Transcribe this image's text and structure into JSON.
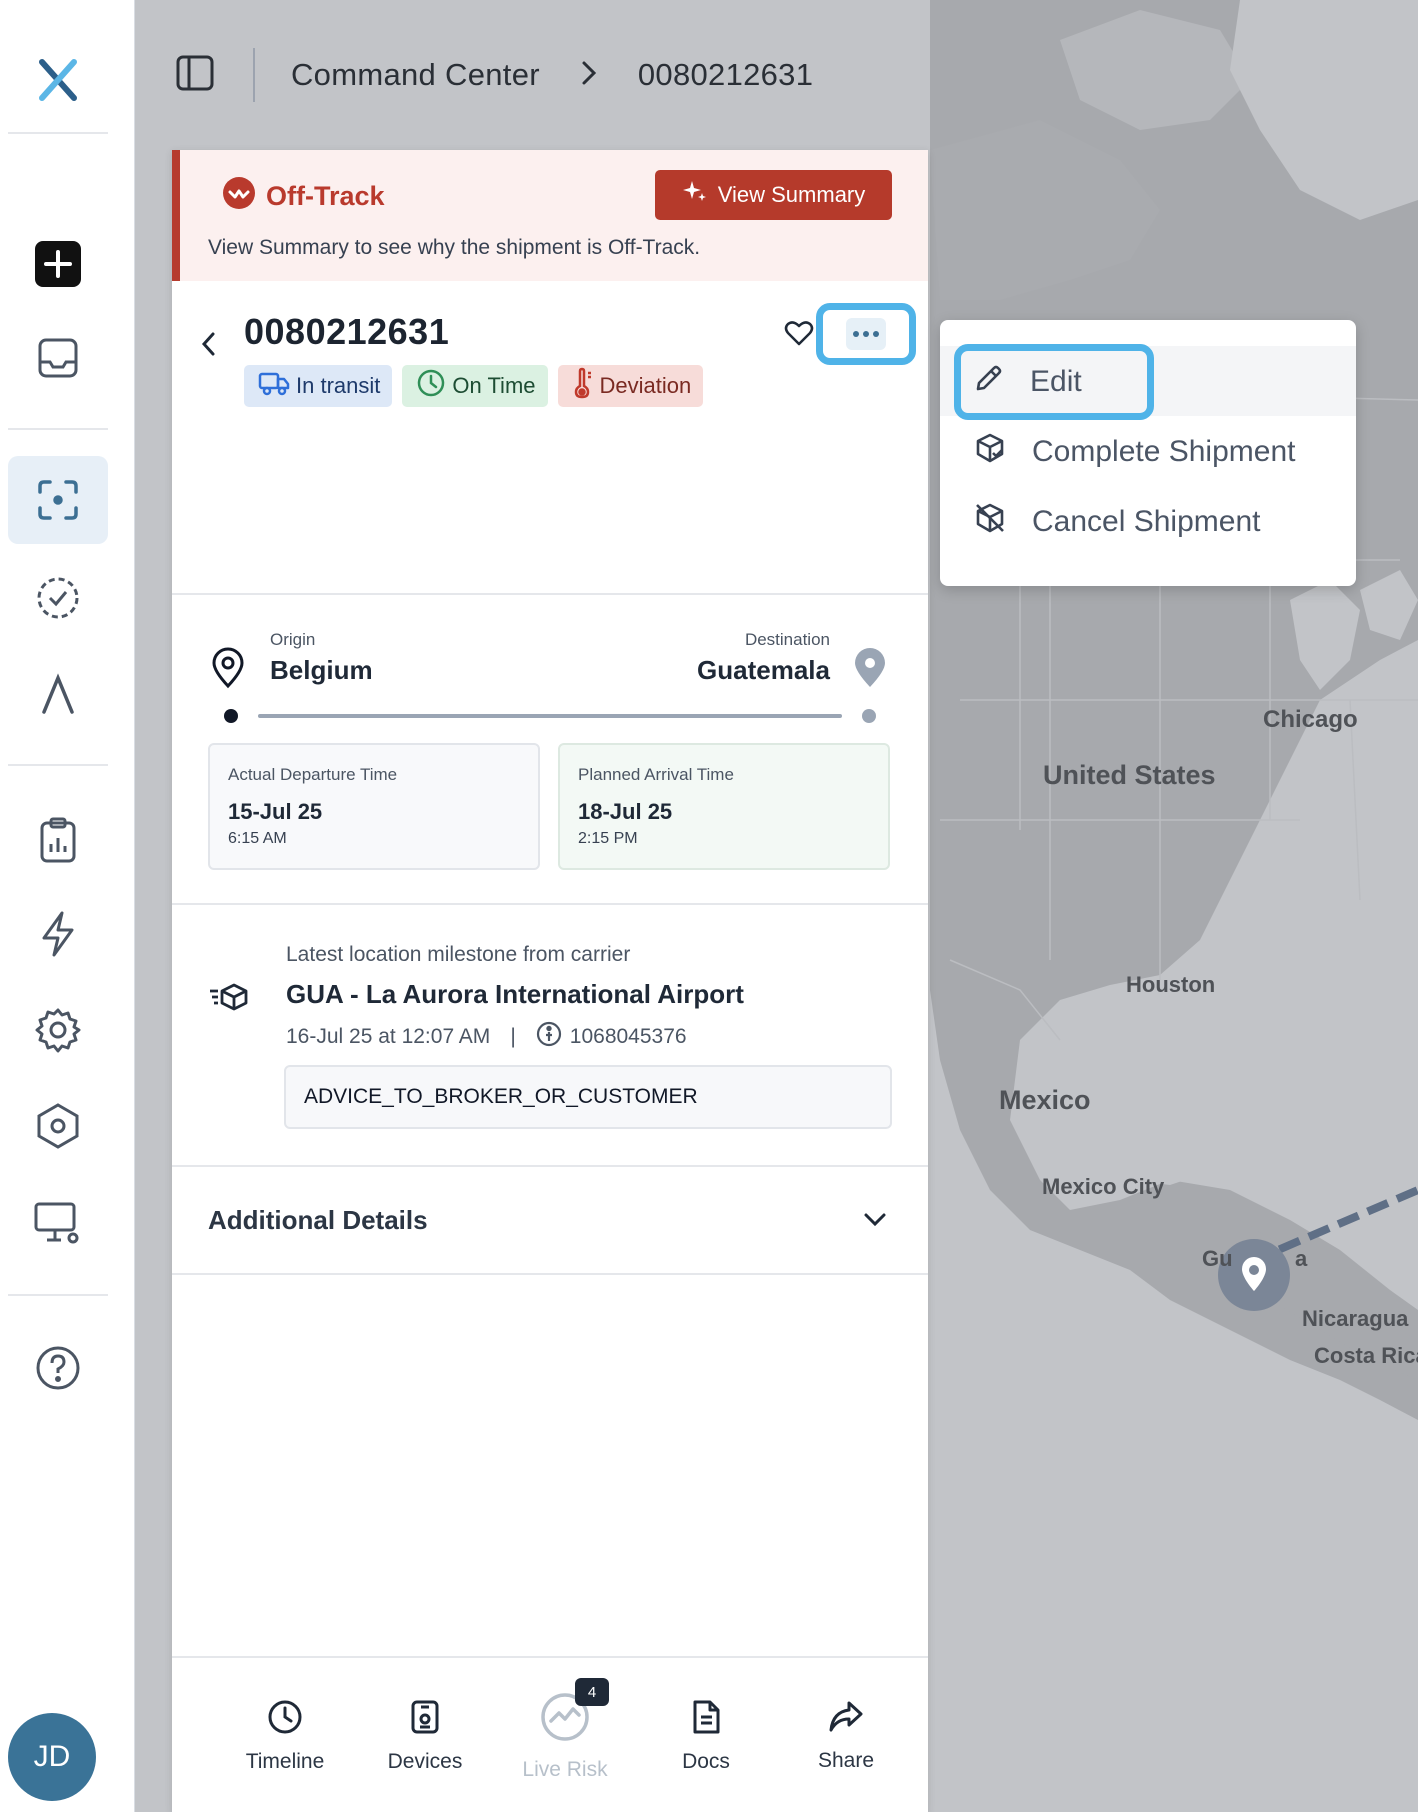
{
  "breadcrumb": {
    "root": "Command Center",
    "current": "0080212631"
  },
  "alert": {
    "status": "Off-Track",
    "button_label": "View Summary",
    "message": "View Summary to see why the shipment is Off-Track."
  },
  "shipment": {
    "id": "0080212631",
    "tags": [
      "In transit",
      "On Time",
      "Deviation"
    ]
  },
  "route": {
    "origin_label": "Origin",
    "origin": "Belgium",
    "destination_label": "Destination",
    "destination": "Guatemala",
    "departure": {
      "label": "Actual Departure Time",
      "date": "15-Jul 25",
      "time": "6:15 AM"
    },
    "arrival": {
      "label": "Planned Arrival Time",
      "date": "18-Jul 25",
      "time": "2:15 PM"
    }
  },
  "milestone": {
    "label": "Latest location milestone from carrier",
    "title": "GUA - La Aurora International Airport",
    "datetime": "16-Jul 25 at 12:07 AM",
    "separator": "|",
    "tracking": "1068045376",
    "code": "ADVICE_TO_BROKER_OR_CUSTOMER"
  },
  "additional_details": "Additional Details",
  "bottom_nav": {
    "timeline": "Timeline",
    "devices": "Devices",
    "live_risk": "Live Risk",
    "live_risk_badge": "4",
    "docs": "Docs",
    "share": "Share"
  },
  "menu": {
    "edit": "Edit",
    "complete": "Complete Shipment",
    "cancel": "Cancel Shipment"
  },
  "map_labels": {
    "chicago": "Chicago",
    "united_states": "United States",
    "houston": "Houston",
    "mexico": "Mexico",
    "mexico_city": "Mexico City",
    "guatemala_partial": "Gu",
    "guatemala_partial_2": "a",
    "nicaragua": "Nicaragua",
    "costa_rica": "Costa Rica"
  },
  "user": {
    "initials": "JD"
  },
  "colors": {
    "alert_red": "#b53a2b",
    "focus_ring": "#4fb3e8",
    "map_land": "#a6a8ac",
    "map_water": "#c2c4c8"
  },
  "icons": [
    "logo-x-icon",
    "plus-icon",
    "inbox-icon",
    "scan-icon",
    "check-circle-icon",
    "caret-up-icon",
    "clipboard-chart-icon",
    "bolt-icon",
    "gear-icon",
    "hexagon-icon",
    "monitor-gear-icon",
    "help-icon",
    "sidebar-toggle-icon",
    "chevron-right-icon",
    "alert-wave-icon",
    "sparkle-icon",
    "chevron-left-icon",
    "heart-icon",
    "more-icon",
    "truck-icon",
    "clock-icon",
    "thermometer-icon",
    "location-pin-icon",
    "map-pin-filled-icon",
    "delivery-box-icon",
    "info-icon",
    "chevron-down-icon",
    "timeline-icon",
    "devices-icon",
    "live-risk-icon",
    "docs-icon",
    "share-icon",
    "pencil-icon",
    "box-check-icon",
    "box-cancel-icon"
  ]
}
